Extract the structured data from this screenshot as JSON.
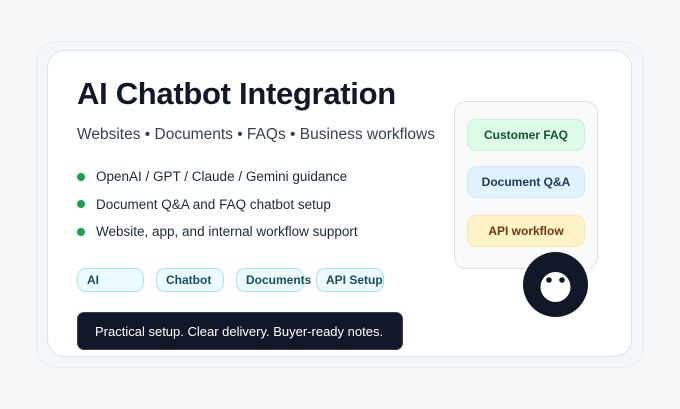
{
  "header": {
    "title": "AI Chatbot Integration",
    "subtitle": "Websites • Documents • FAQs • Business workflows"
  },
  "features": [
    "OpenAI / GPT / Claude / Gemini guidance",
    "Document Q&A and FAQ chatbot setup",
    "Website, app, and internal workflow support"
  ],
  "tags": [
    "AI",
    "Chatbot",
    "Documents",
    "API Setup"
  ],
  "banner": "Practical setup. Clear delivery. Buyer-ready notes.",
  "side_panel": {
    "items": [
      "Customer FAQ",
      "Document Q&A",
      "API workflow"
    ]
  },
  "icons": {
    "bullet": "green-dot-icon",
    "bot": "chatbot-face-icon"
  },
  "colors": {
    "accent_green": "#16a34a",
    "dark": "#111827",
    "tag_border": "#a5e5f0",
    "faq_bg": "#dcfce7",
    "doc_bg": "#e0f2fe",
    "api_bg": "#fef3c7"
  }
}
